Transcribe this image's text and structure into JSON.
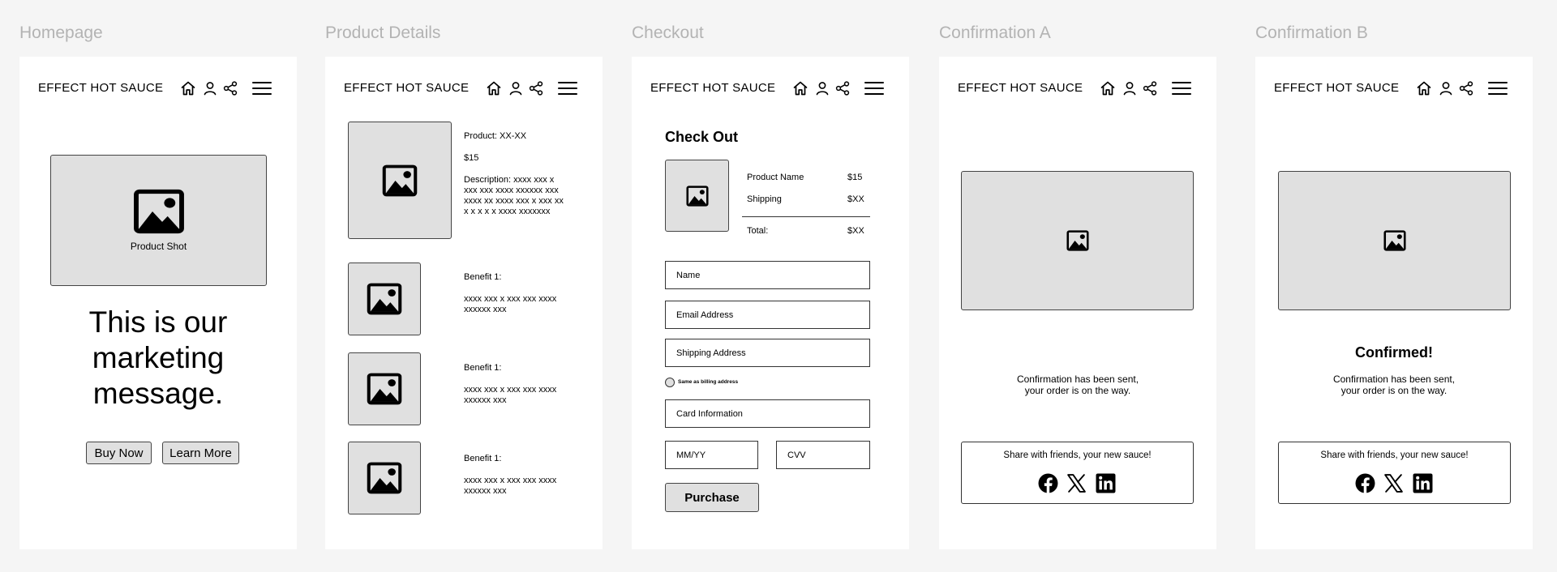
{
  "brand": "EFFECT HOT SAUCE",
  "frames": {
    "homepage": {
      "title": "Homepage",
      "hero_caption": "Product Shot",
      "marketing_line1": "This is our",
      "marketing_line2": "marketing",
      "marketing_line3": "message.",
      "buy_now": "Buy Now",
      "learn_more": "Learn More"
    },
    "product": {
      "title": "Product Details",
      "product_name": "Product: XX-XX",
      "price": "$15",
      "description": [
        "Description: xxxx xxx x",
        "xxx xxx xxxx xxxxxx xxx",
        "xxxx xx xxxx xxx x xxx xx",
        "x x x x x xxxx  xxxxxxx"
      ],
      "benefits": [
        {
          "label": "Benefit 1:",
          "line1": "xxxx xxx x xxx xxx xxxx",
          "line2": "xxxxxx xxx"
        },
        {
          "label": "Benefit 1:",
          "line1": "xxxx xxx x xxx xxx xxxx",
          "line2": "xxxxxx xxx"
        },
        {
          "label": "Benefit 1:",
          "line1": "xxxx xxx x xxx xxx xxxx",
          "line2": "xxxxxx xxx"
        }
      ]
    },
    "checkout": {
      "title": "Checkout",
      "heading": "Check Out",
      "summary": {
        "product_label": "Product Name",
        "product_price": "$15",
        "shipping_label": "Shipping",
        "shipping_price": "$XX",
        "total_label": "Total:",
        "total_price": "$XX"
      },
      "name_placeholder": "Name",
      "email_placeholder": "Email Address",
      "shipping_placeholder": "Shipping Address",
      "billing_checkbox": "Same as billing address",
      "card_placeholder": "Card Information",
      "expiry_placeholder": "MM/YY",
      "cvv_placeholder": "CVV",
      "purchase": "Purchase"
    },
    "confirm_a": {
      "title": "Confirmation A",
      "message_line1": "Confirmation has been sent,",
      "message_line2": "your order is on the way.",
      "share_label": "Share with friends, your new sauce!"
    },
    "confirm_b": {
      "title": "Confirmation B",
      "heading": "Confirmed!",
      "message_line1": "Confirmation has been sent,",
      "message_line2": "your order is on the way.",
      "share_label": "Share with friends, your new sauce!"
    }
  },
  "icons": [
    "home-icon",
    "user-icon",
    "share-icon",
    "menu-icon",
    "image-icon",
    "facebook-icon",
    "x-icon",
    "linkedin-icon"
  ],
  "colors": {
    "background": "#f5f5f5",
    "frame": "#ffffff",
    "placeholder_fill": "#e0e0e0",
    "frame_title": "#b3b3b3",
    "ink": "#000000"
  }
}
